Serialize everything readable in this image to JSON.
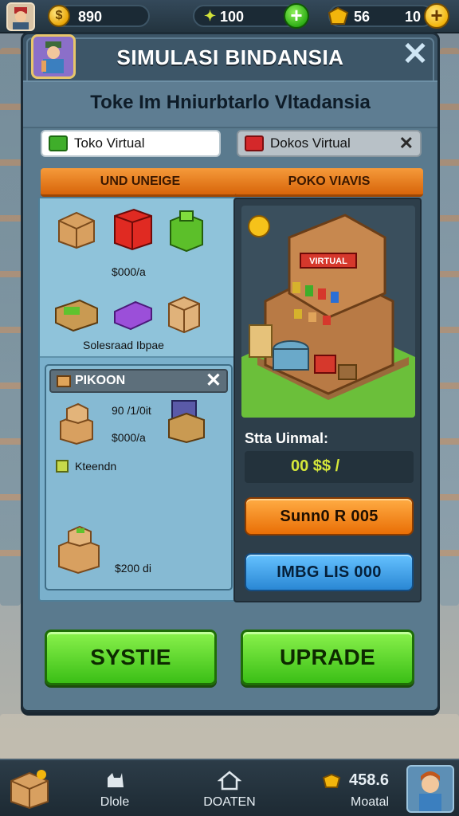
{
  "topbar": {
    "coins": "890",
    "gems": "100",
    "tickets": "56",
    "level": "10"
  },
  "panel": {
    "title": "SIMULASI BINDANSIA",
    "close_glyph": "✕",
    "subtitle": "Toke Im Hniurbtarlo Vltadansia"
  },
  "fields": {
    "left": "Toko Virtual",
    "right": "Dokos Virtual",
    "right_clear_glyph": "✕"
  },
  "left_column": {
    "header": "UND UNEIGE",
    "price_top": "$000/a",
    "caption": "Solesraad Ibpae",
    "sub_panel": {
      "header": "PIKOON",
      "close_glyph": "✕",
      "line1": "90 /1/0it",
      "line2": "$000/a",
      "checkbox_label": "Kteendn",
      "bottom_price": "$200 di"
    }
  },
  "right_column": {
    "header": "POKO VIAVIS",
    "shop_sign": "VIRTUAL",
    "stat_label": "Stta Uinmal:",
    "stat_value": "00 $$ /",
    "orange_button": "Sunn0 R 005",
    "blue_button": "IMBG LIS 000"
  },
  "actions": {
    "left_button": "SYSTIE",
    "right_button": "UPRADE"
  },
  "bottom_nav": {
    "item1": "Dlole",
    "item2": "DOATEN",
    "stat_value": "458.6",
    "stat_label": "Moatal"
  },
  "colors": {
    "panel": "#3d5668",
    "orange_header": "#e9791a",
    "green_button": "#3bbf16",
    "blue_button": "#2a87d4",
    "orange_button": "#e96f06"
  },
  "icons": [
    "shopkeeper-avatar-icon",
    "coin-icon",
    "gem-icon",
    "plus-icon",
    "ticket-icon",
    "close-icon",
    "box-icon",
    "shop-icon",
    "home-icon",
    "cat-icon"
  ]
}
